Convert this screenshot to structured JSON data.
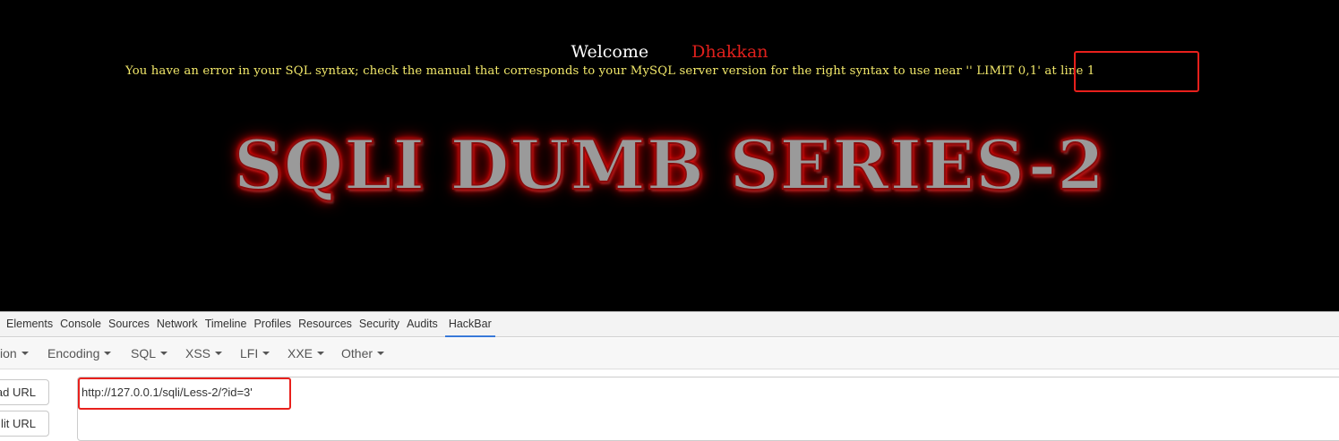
{
  "page": {
    "welcome": "Welcome",
    "user_name": "Dhakkan",
    "sql_error": "You have an error in your SQL syntax; check the manual that corresponds to your MySQL server version for the right syntax to use near '' LIMIT 0,1' at line 1",
    "banner_title": "SQLI DUMB SERIES-2",
    "colors": {
      "background": "#000000",
      "welcome": "#ffffff",
      "user_name": "#e0201c",
      "error_text": "#f2e86a",
      "highlight": "#e8201c"
    }
  },
  "devtools": {
    "tabs": [
      {
        "label": "Elements"
      },
      {
        "label": "Console"
      },
      {
        "label": "Sources"
      },
      {
        "label": "Network"
      },
      {
        "label": "Timeline"
      },
      {
        "label": "Profiles"
      },
      {
        "label": "Resources"
      },
      {
        "label": "Security"
      },
      {
        "label": "Audits"
      },
      {
        "label": "HackBar",
        "active": true
      }
    ]
  },
  "hackbar": {
    "menus": [
      {
        "label": "ion"
      },
      {
        "label": "Encoding"
      },
      {
        "label": "SQL"
      },
      {
        "label": "XSS"
      },
      {
        "label": "LFI"
      },
      {
        "label": "XXE"
      },
      {
        "label": "Other"
      }
    ],
    "load_url_label": "ad URL",
    "split_url_label": "lit URL",
    "url_value": "http://127.0.0.1/sqli/Less-2/?id=3'"
  }
}
